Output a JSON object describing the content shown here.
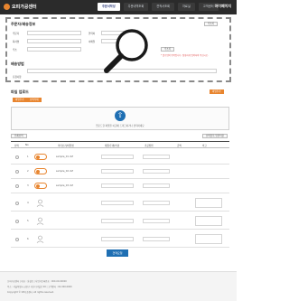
{
  "header": {
    "logo_text": "오피가공센터",
    "tabs": [
      {
        "label": "주문서작성"
      },
      {
        "label": "주문내역조회"
      },
      {
        "label": "견적서조회"
      },
      {
        "label": "자료실"
      },
      {
        "label": "고객센터"
      }
    ],
    "right_label": "마이페이지"
  },
  "order_info": {
    "title": "주문자/배송정보",
    "load_button": "주소록",
    "name_label": "주문자",
    "phone_label": "연락처",
    "company_label": "회사명",
    "email_label": "이메일",
    "address_label": "주소",
    "warning": "* 필수입력 항목입니다. 정확하게 입력하여 주십시오."
  },
  "delivery": {
    "title": "배송방법",
    "note_label": "요청사항"
  },
  "files": {
    "title": "파일 업로드",
    "add_button": "파일추가",
    "delete_button": "선택삭제",
    "upload_hint": "업로드할 파일을 이곳에 드래그하거나 클릭하세요"
  },
  "table": {
    "left_button": "전체선택",
    "right_button": "선택항목 일괄적용",
    "headers": [
      "선택",
      "No",
      "미리보기/파일명",
      "재질/두께/수량",
      "가공방법",
      "금액",
      "비고"
    ],
    "rows": [
      {
        "no": "1",
        "file": "sample_01.dxf"
      },
      {
        "no": "2",
        "file": "sample_02.dxf"
      },
      {
        "no": "3",
        "file": "sample_03.dxf"
      },
      {
        "no": "4",
        "file": ""
      },
      {
        "no": "5",
        "file": ""
      },
      {
        "no": "6",
        "file": ""
      }
    ]
  },
  "submit_label": "견적요청",
  "footer": {
    "line1": "오피가공센터 | 대표 : 홍길동 | 사업자등록번호 : 000-00-00000",
    "line2": "주소 : 서울특별시 금천구 가산디지털로 00 | 고객센터 : 02-000-0000",
    "line3": "Copyright © OP가공센터. All rights reserved."
  },
  "colors": {
    "accent": "#e8852f",
    "primary": "#1f6fb3",
    "header_bg": "#2b2b2b"
  }
}
